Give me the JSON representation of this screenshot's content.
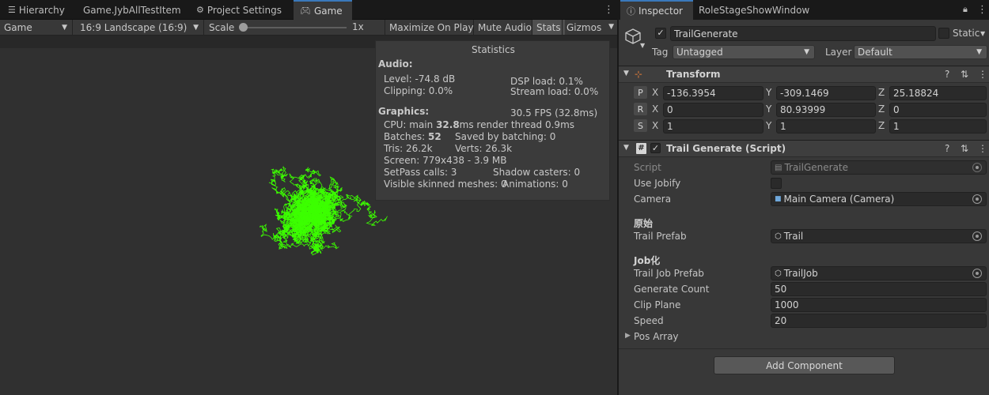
{
  "left_tabs": [
    {
      "label": "Hierarchy",
      "icon": "hierarchy-icon"
    },
    {
      "label": "Game.JybAllTestItem"
    },
    {
      "label": "Project Settings",
      "icon": "gear-icon"
    },
    {
      "label": "Game",
      "icon": "gamepad-icon"
    }
  ],
  "game_toolbar": {
    "display": "Game",
    "aspect": "16:9 Landscape (16:9)",
    "scale_label": "Scale",
    "scale_value": "1x",
    "maximize": "Maximize On Play",
    "mute": "Mute Audio",
    "stats": "Stats",
    "gizmos": "Gizmos"
  },
  "stats": {
    "title": "Statistics",
    "audio_header": "Audio:",
    "level": "Level: -74.8 dB",
    "clipping": "Clipping: 0.0%",
    "dsp_load": "DSP load: 0.1%",
    "stream_load": "Stream load: 0.0%",
    "graphics_header": "Graphics:",
    "fps": "30.5 FPS (32.8ms)",
    "cpu_prefix": "CPU: main ",
    "cpu_main": "32.8",
    "cpu_suffix": "ms  render thread 0.9ms",
    "batches_prefix": "Batches: ",
    "batches": "52",
    "saved_batching": "Saved by batching: 0",
    "tris": "Tris: 26.2k",
    "verts": "Verts: 26.3k",
    "screen": "Screen: 779x438 - 3.9 MB",
    "setpass": "SetPass calls: 3",
    "shadow_casters": "Shadow casters: 0",
    "skinned": "Visible skinned meshes: 0",
    "animations": "Animations: 0"
  },
  "inspector_tabs": [
    {
      "label": "Inspector",
      "icon": "info-icon"
    },
    {
      "label": "RoleStageShowWindow"
    }
  ],
  "gameobject": {
    "name": "TrailGenerate",
    "static_label": "Static",
    "tag_label": "Tag",
    "tag_value": "Untagged",
    "layer_label": "Layer",
    "layer_value": "Default"
  },
  "transform": {
    "title": "Transform",
    "rows": [
      {
        "key": "P",
        "x": "-136.3954",
        "y": "-309.1469",
        "z": "25.18824"
      },
      {
        "key": "R",
        "x": "0",
        "y": "80.93999",
        "z": "0"
      },
      {
        "key": "S",
        "x": "1",
        "y": "1",
        "z": "1"
      }
    ],
    "axis_x": "X",
    "axis_y": "Y",
    "axis_z": "Z"
  },
  "script_component": {
    "title": "Trail Generate (Script)",
    "script_label": "Script",
    "script_value": "TrailGenerate",
    "use_jobify_label": "Use Jobify",
    "camera_label": "Camera",
    "camera_value": "Main Camera (Camera)",
    "section_original": "原始",
    "trail_prefab_label": "Trail Prefab",
    "trail_prefab_value": "Trail",
    "section_job": "Job化",
    "trail_job_prefab_label": "Trail Job Prefab",
    "trail_job_prefab_value": "TrailJob",
    "generate_count_label": "Generate Count",
    "generate_count_value": "50",
    "clip_plane_label": "Clip Plane",
    "clip_plane_value": "1000",
    "speed_label": "Speed",
    "speed_value": "20",
    "pos_array_label": "Pos Array"
  },
  "add_component": "Add Component",
  "colors": {
    "trail_green": "#3cff00",
    "accent_blue": "#3a79bb",
    "panel_bg": "#383838",
    "game_bg": "#303030"
  }
}
